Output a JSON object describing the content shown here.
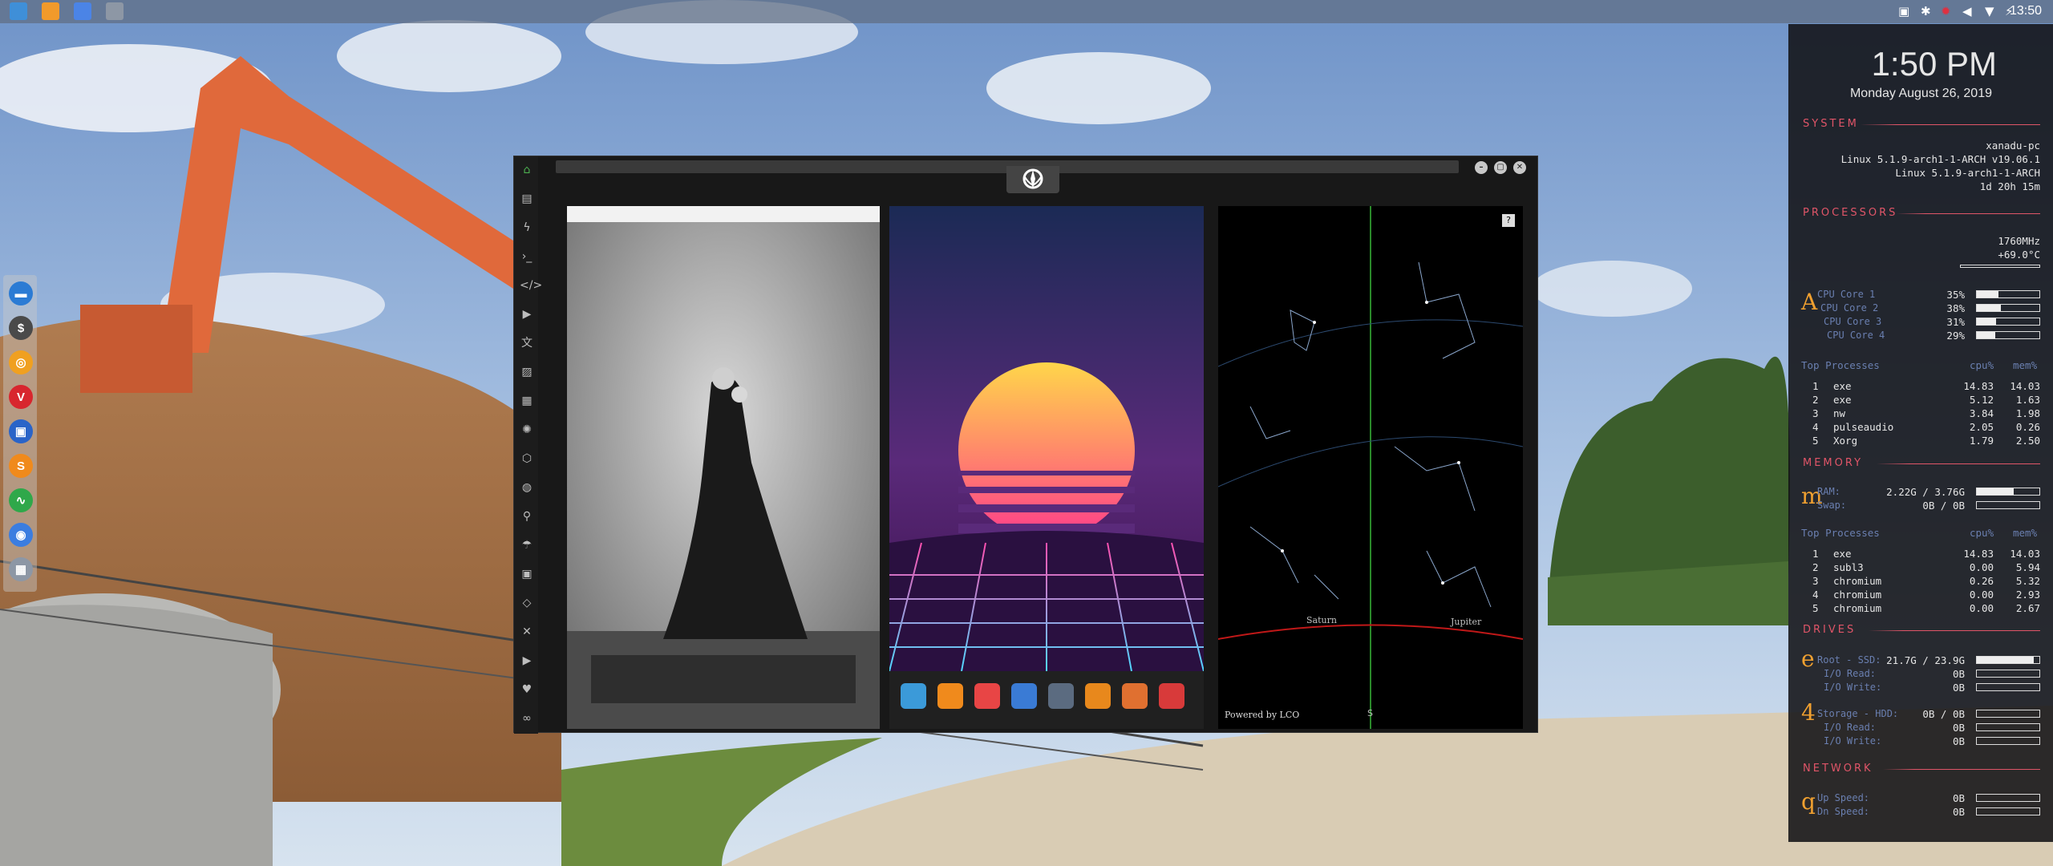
{
  "topbar": {
    "apps": [
      {
        "icon": "file-manager-icon",
        "color": "#3f8fd8"
      },
      {
        "icon": "sublime-text-icon",
        "color": "#f19a2b"
      },
      {
        "icon": "chromium-icon",
        "color": "#4b84e6"
      },
      {
        "icon": "workspace-grid-icon",
        "color": "#8d97a5"
      }
    ],
    "time": "13:50"
  },
  "dock": {
    "items": [
      {
        "icon": "files-icon",
        "glyph": "▬",
        "color": "#2b7bd4"
      },
      {
        "icon": "money-manager-icon",
        "glyph": "$",
        "color": "#4a4a4a"
      },
      {
        "icon": "lifebuoy-icon",
        "glyph": "◎",
        "color": "#f0a020"
      },
      {
        "icon": "vivaldi-icon",
        "glyph": "V",
        "color": "#d8262e"
      },
      {
        "icon": "screenshot-icon",
        "glyph": "▣",
        "color": "#2a64c8"
      },
      {
        "icon": "sublime-s-icon",
        "glyph": "S",
        "color": "#f08a1c"
      },
      {
        "icon": "system-monitor-icon",
        "glyph": "∿",
        "color": "#2fa84a"
      },
      {
        "icon": "chrome-icon",
        "glyph": "◉",
        "color": "#3b7de0"
      },
      {
        "icon": "grid-icon",
        "glyph": "▦",
        "color": "#8d97a5"
      }
    ]
  },
  "window": {
    "sidebar_icons": [
      "home-icon",
      "document-icon",
      "bolt-icon",
      "terminal-icon",
      "code-icon",
      "play-icon",
      "translate-icon",
      "image-icon",
      "news-icon",
      "settings-icon",
      "hexagon-icon",
      "globe-icon",
      "search-icon",
      "umbrella-icon",
      "contact-icon",
      "chevrons-icon",
      "expand-icon",
      "youtube-icon",
      "heart-icon",
      "infinity-icon"
    ],
    "controls": {
      "minimize": "–",
      "maximize": "▢",
      "close": "✕"
    },
    "launcher_icons": [
      {
        "icon": "calculator-icon",
        "color": "#3b9ad9"
      },
      {
        "icon": "arrow-icon",
        "color": "#f08a1c"
      },
      {
        "icon": "calendar-icon",
        "color": "#e84545"
      },
      {
        "icon": "globe-icon",
        "color": "#3a7bd5"
      },
      {
        "icon": "clock-icon",
        "color": "#5b6b80"
      },
      {
        "icon": "magnifier-icon",
        "color": "#e8881c"
      },
      {
        "icon": "picture-icon",
        "color": "#e07030"
      },
      {
        "icon": "mountain-icon",
        "color": "#d83a3a"
      }
    ],
    "star_panel": {
      "help": "?",
      "labels": [
        "Saturn",
        "Jupiter"
      ],
      "footer": "Powered by LCO",
      "meridian_label": "S"
    }
  },
  "conky": {
    "time": "1:50 PM",
    "date": "Monday August 26, 2019",
    "system": {
      "heading": "SYSTEM",
      "hostname": "xanadu-pc",
      "kernel1": "Linux 5.1.9-arch1-1-ARCH v19.06.1",
      "kernel2": "Linux 5.1.9-arch1-1-ARCH",
      "uptime": "1d 20h 15m"
    },
    "processors": {
      "heading": "PROCESSORS",
      "freq": "1760MHz",
      "temp": "+69.0°C",
      "letter": "A",
      "cores": [
        {
          "label": "CPU Core 1",
          "value": "35%",
          "pct": 35
        },
        {
          "label": "CPU Core 2",
          "value": "38%",
          "pct": 38
        },
        {
          "label": "CPU Core 3",
          "value": "31%",
          "pct": 31
        },
        {
          "label": "CPU Core 4",
          "value": "29%",
          "pct": 29
        }
      ],
      "top_label": "Top Processes",
      "col_cpu": "cpu%",
      "col_mem": "mem%",
      "procs": [
        {
          "rank": "1",
          "name": "exe",
          "cpu": "14.83",
          "mem": "14.03"
        },
        {
          "rank": "2",
          "name": "exe",
          "cpu": "5.12",
          "mem": "1.63"
        },
        {
          "rank": "3",
          "name": "nw",
          "cpu": "3.84",
          "mem": "1.98"
        },
        {
          "rank": "4",
          "name": "pulseaudio",
          "cpu": "2.05",
          "mem": "0.26"
        },
        {
          "rank": "5",
          "name": "Xorg",
          "cpu": "1.79",
          "mem": "2.50"
        }
      ]
    },
    "memory": {
      "heading": "MEMORY",
      "letter": "m",
      "ram_label": "RAM:",
      "ram": "2.22G / 3.76G",
      "ram_pct": 59,
      "swap_label": "Swap:",
      "swap": "0B / 0B",
      "swap_pct": 0,
      "top_label": "Top Processes",
      "col_cpu": "cpu%",
      "col_mem": "mem%",
      "procs": [
        {
          "rank": "1",
          "name": "exe",
          "cpu": "14.83",
          "mem": "14.03"
        },
        {
          "rank": "2",
          "name": "subl3",
          "cpu": "0.00",
          "mem": "5.94"
        },
        {
          "rank": "3",
          "name": "chromium",
          "cpu": "0.26",
          "mem": "5.32"
        },
        {
          "rank": "4",
          "name": "chromium",
          "cpu": "0.00",
          "mem": "2.93"
        },
        {
          "rank": "5",
          "name": "chromium",
          "cpu": "0.00",
          "mem": "2.67"
        }
      ]
    },
    "drives": {
      "heading": "DRIVES",
      "letter1": "e",
      "root_label": "Root - SSD:",
      "root": "21.7G / 23.9G",
      "root_pct": 91,
      "io_read_label": "I/O Read:",
      "io_write_label": "I/O Write:",
      "root_read": "0B",
      "root_write": "0B",
      "letter2": "4",
      "storage_label": "Storage - HDD:",
      "storage": "0B / 0B",
      "storage_pct": 0,
      "storage_read": "0B",
      "storage_write": "0B"
    },
    "network": {
      "heading": "NETWORK",
      "letter": "q",
      "up_label": "Up Speed:",
      "down_label": "Dn Speed:",
      "up": "0B",
      "down": "0B"
    }
  }
}
